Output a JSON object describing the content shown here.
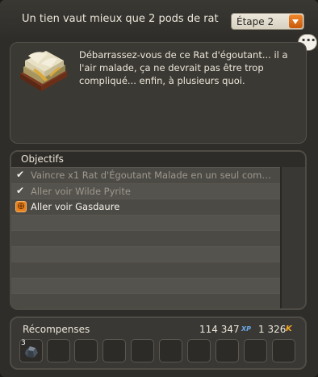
{
  "header": {
    "title": "Un tien vaut mieux que 2 pods de rat",
    "step": "Étape 2"
  },
  "description": "Débarrassez-vous de ce Rat d'égoutant... il a l'air malade, ça ne devrait pas être trop compliqué... enfin, à plusieurs quoi.",
  "objectives": {
    "title": "Objectifs",
    "items": [
      {
        "label": "Vaincre x1 Rat d'Égoutant Malade en un seul com…",
        "status": "done"
      },
      {
        "label": "Aller voir Wilde Pyrite",
        "status": "done"
      },
      {
        "label": "Aller voir Gasdaure",
        "status": "active"
      }
    ]
  },
  "rewards": {
    "title": "Récompenses",
    "xp": "114 347",
    "xp_tag": "XP",
    "kamas": "1 326",
    "kama_symbol": "K",
    "item_quantity": "3"
  },
  "colors": {
    "accent": "#e8801f",
    "panel": "#2f2d29"
  }
}
